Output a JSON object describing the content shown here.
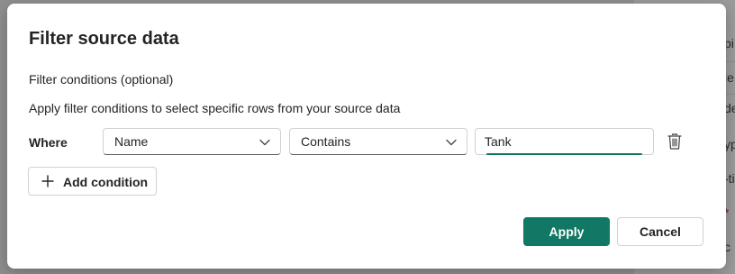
{
  "background": {
    "fragments": [
      "pi",
      "le",
      "de",
      "yp",
      "-ti",
      "*",
      "c"
    ]
  },
  "dialog": {
    "title": "Filter source data",
    "subtitle": "Filter conditions (optional)",
    "description": "Apply filter conditions to select specific rows from your source data",
    "condition": {
      "where_label": "Where",
      "field": "Name",
      "operator": "Contains",
      "value": "Tank",
      "field_icon": "chevron-down-icon",
      "operator_icon": "chevron-down-icon",
      "delete_icon": "trash-icon"
    },
    "add_condition_label": "Add condition",
    "add_condition_icon": "plus-icon",
    "apply_label": "Apply",
    "cancel_label": "Cancel"
  },
  "colors": {
    "accent": "#117865",
    "overlay": "#8f8f8f"
  }
}
